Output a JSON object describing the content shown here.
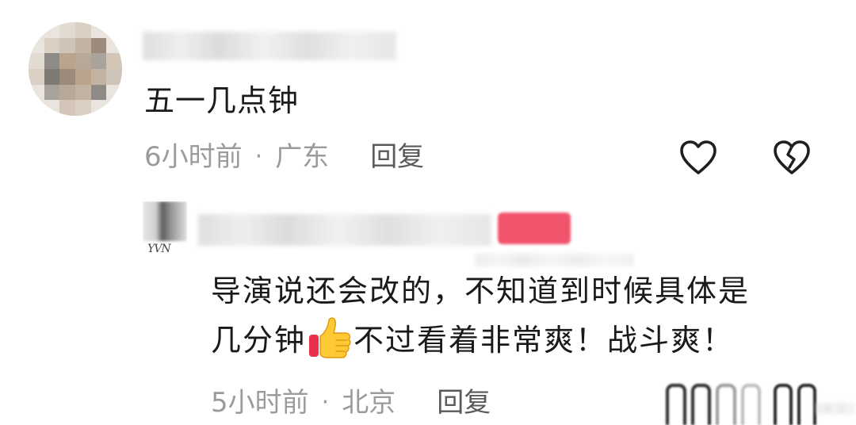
{
  "comment": {
    "text": "五一几点钟",
    "time": "6小时前",
    "separator": "·",
    "location": "广东",
    "reply_label": "回复"
  },
  "reply": {
    "line1": "导演说还会改的，不知道到时候具体是",
    "line2_before": "几分钟",
    "line2_after": "不过看着非常爽！战斗爽！",
    "time": "5小时前",
    "separator": "·",
    "location": "北京",
    "reply_label": "回复",
    "avatar_watermark": "YVN"
  },
  "icons": {
    "like": "heart-outline-icon",
    "dislike": "broken-heart-icon",
    "thumbs_up": "thumbs-up-emoji"
  },
  "colors": {
    "text": "#1a1a1a",
    "meta": "#9b9b9b",
    "badge": "#f0536b"
  }
}
